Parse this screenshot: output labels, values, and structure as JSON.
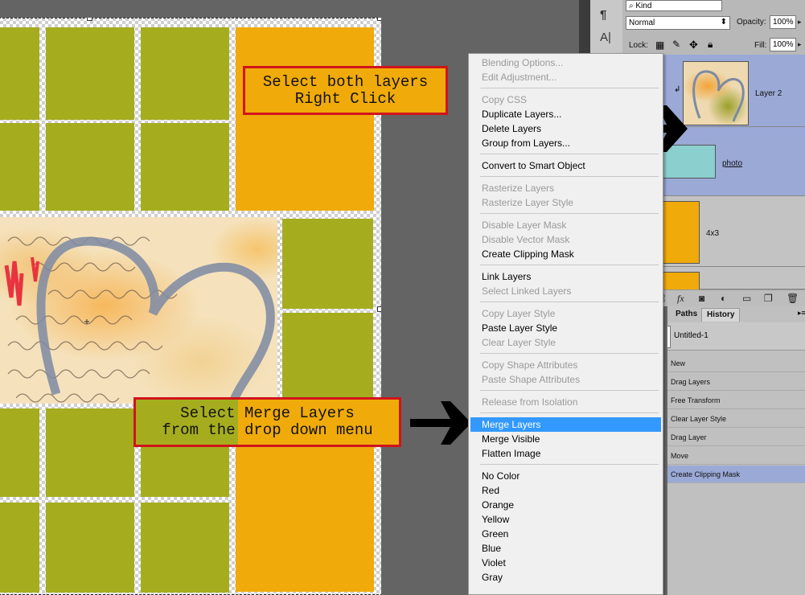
{
  "callouts": {
    "top": [
      "Select both layers",
      "Right Click"
    ],
    "bottom": [
      "Select Merge Layers",
      "from the drop down menu"
    ]
  },
  "layers_panel": {
    "kind_label": "Kind",
    "blend_mode": "Normal",
    "opacity_label": "Opacity:",
    "opacity_value": "100%",
    "lock_label": "Lock:",
    "fill_label": "Fill:",
    "fill_value": "100%",
    "layers": [
      {
        "name": "Layer 2",
        "selected": true
      },
      {
        "name": "photo",
        "selected": true
      },
      {
        "name": "4x3",
        "selected": false
      }
    ],
    "footer_icons": [
      "link-icon",
      "fx-icon",
      "mask-icon",
      "adjustment-icon",
      "folder-icon",
      "new-layer-icon",
      "trash-icon"
    ]
  },
  "history_panel": {
    "tabs": [
      "Paths",
      "History"
    ],
    "active_tab": "History",
    "snapshot": "Untitled-1",
    "items": [
      "New",
      "Drag Layers",
      "Free Transform",
      "Clear Layer Style",
      "Drag Layer",
      "Move",
      "Create Clipping Mask"
    ],
    "current": "Create Clipping Mask"
  },
  "context_menu": {
    "groups": [
      [
        {
          "label": "Blending Options...",
          "enabled": false
        },
        {
          "label": "Edit Adjustment...",
          "enabled": false
        }
      ],
      [
        {
          "label": "Copy CSS",
          "enabled": false
        },
        {
          "label": "Duplicate Layers...",
          "enabled": true
        },
        {
          "label": "Delete Layers",
          "enabled": true
        },
        {
          "label": "Group from Layers...",
          "enabled": true
        }
      ],
      [
        {
          "label": "Convert to Smart Object",
          "enabled": true
        }
      ],
      [
        {
          "label": "Rasterize Layers",
          "enabled": false
        },
        {
          "label": "Rasterize Layer Style",
          "enabled": false
        }
      ],
      [
        {
          "label": "Disable Layer Mask",
          "enabled": false
        },
        {
          "label": "Disable Vector Mask",
          "enabled": false
        },
        {
          "label": "Create Clipping Mask",
          "enabled": true
        }
      ],
      [
        {
          "label": "Link Layers",
          "enabled": true
        },
        {
          "label": "Select Linked Layers",
          "enabled": false
        }
      ],
      [
        {
          "label": "Copy Layer Style",
          "enabled": false
        },
        {
          "label": "Paste Layer Style",
          "enabled": true
        },
        {
          "label": "Clear Layer Style",
          "enabled": false
        }
      ],
      [
        {
          "label": "Copy Shape Attributes",
          "enabled": false
        },
        {
          "label": "Paste Shape Attributes",
          "enabled": false
        }
      ],
      [
        {
          "label": "Release from Isolation",
          "enabled": false
        }
      ],
      [
        {
          "label": "Merge Layers",
          "enabled": true,
          "highlighted": true
        },
        {
          "label": "Merge Visible",
          "enabled": true
        },
        {
          "label": "Flatten Image",
          "enabled": true
        }
      ],
      [
        {
          "label": "No Color",
          "enabled": true
        },
        {
          "label": "Red",
          "enabled": true
        },
        {
          "label": "Orange",
          "enabled": true
        },
        {
          "label": "Yellow",
          "enabled": true
        },
        {
          "label": "Green",
          "enabled": true
        },
        {
          "label": "Blue",
          "enabled": true
        },
        {
          "label": "Violet",
          "enabled": true
        },
        {
          "label": "Gray",
          "enabled": true
        }
      ]
    ]
  },
  "colors": {
    "green_tile": "#a5ad1e",
    "orange_tile": "#f0ab0a",
    "callout_border": "#d0141b",
    "menu_highlight": "#3399ff",
    "selected_layer": "#9aa9d6"
  }
}
